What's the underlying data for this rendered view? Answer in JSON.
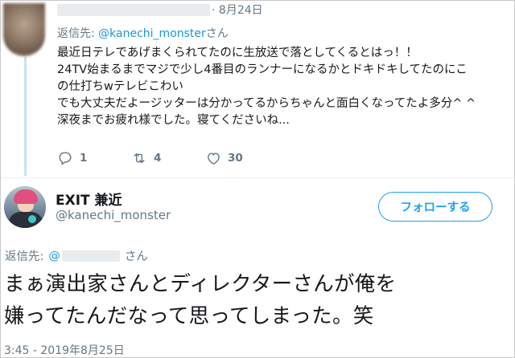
{
  "parent_tweet": {
    "date": "8月24日",
    "reply_to_label": "返信先:",
    "reply_to_handle": "@kanechi_monster",
    "reply_to_suffix": "さん",
    "body_lines": [
      "最近日テレであげまくられてたのに生放送で落としてくるとはっ！！",
      "24TV始まるまでマジで少し4番目のランナーになるかとドキドキしてたのにこ",
      "の仕打ちwテレビこわい",
      "でも大丈夫だよージッターは分かってるからちゃんと面白くなってたよ多分^ ^",
      "深夜までお疲れ様でした。寝てくださいね..."
    ],
    "actions": {
      "reply_count": "1",
      "retweet_count": "4",
      "like_count": "30",
      "reply_icon": "reply-icon",
      "retweet_icon": "retweet-icon",
      "like_icon": "heart-icon"
    }
  },
  "main_tweet": {
    "display_name": "EXIT 兼近",
    "handle": "@kanechi_monster",
    "follow_label": "フォローする",
    "reply_to_label": "返信先:",
    "reply_to_handle": "@",
    "reply_to_suffix": "さん",
    "text_lines": [
      "まぁ演出家さんとディレクターさんが俺を",
      "嫌ってたんだなって思ってしまった。笑"
    ],
    "timestamp": "3:45 - 2019年8月25日"
  },
  "colors": {
    "accent": "#1da1f2",
    "mention": "#1b95e0",
    "muted": "#657786",
    "thread_line": "#c4e3f8"
  }
}
